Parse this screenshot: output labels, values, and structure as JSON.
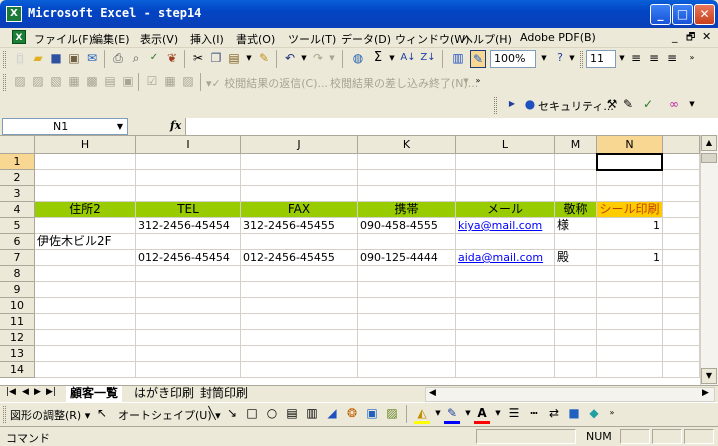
{
  "window": {
    "title": "Microsoft Excel - step14",
    "app_icon": "X",
    "min": "_",
    "max": "□",
    "close": "✕"
  },
  "menu": {
    "items": [
      "ファイル(F)",
      "編集(E)",
      "表示(V)",
      "挿入(I)",
      "書式(O)",
      "ツール(T)",
      "データ(D)",
      "ウィンドウ(W)",
      "ヘルプ(H)",
      "Adobe PDF(B)"
    ],
    "mdi_min": "_",
    "mdi_restore": "🗗",
    "mdi_close": "✕"
  },
  "toolbar": {
    "zoom": "100%",
    "font_size": "11",
    "review_send": "校閲結果の返信(C)...",
    "review_end": "校閲結果の差し込み終了(N)...",
    "security": "セキュリティ..."
  },
  "formula": {
    "namebox": "N1",
    "fx": "fx",
    "content": ""
  },
  "grid": {
    "columns": [
      {
        "label": "H"
      },
      {
        "label": "I"
      },
      {
        "label": "J"
      },
      {
        "label": "K"
      },
      {
        "label": "L"
      },
      {
        "label": "M"
      },
      {
        "label": "N"
      }
    ],
    "rows": [
      "1",
      "2",
      "3",
      "4",
      "5",
      "6",
      "7",
      "8",
      "9",
      "10",
      "11",
      "12",
      "13",
      "14"
    ],
    "headers": [
      "住所2",
      "TEL",
      "FAX",
      "携帯",
      "メール",
      "敬称",
      "シール印刷"
    ],
    "data": {
      "r5": {
        "tel": "312-2456-45454",
        "fax": "312-2456-45455",
        "mobile": "090-458-4555",
        "mail": "kiya@mail.com",
        "title": "様",
        "print": "1"
      },
      "r6": {
        "addr2": "伊佐木ビル2F"
      },
      "r7": {
        "tel": "012-2456-45454",
        "fax": "012-2456-45455",
        "mobile": "090-125-4444",
        "mail": "aida@mail.com",
        "title": "殿",
        "print": "1"
      }
    }
  },
  "sheets": [
    "顧客一覧",
    "はがき印刷",
    "封筒印刷"
  ],
  "drawing": {
    "adjust": "図形の調整(R)",
    "autoshape": "オートシェイプ(U)"
  },
  "status": {
    "mode": "コマンド",
    "num": "NUM"
  },
  "colors": {
    "header_green": "#99cc00",
    "header_orange": "#ffcc00",
    "title_blue": "#0a4fd0"
  }
}
